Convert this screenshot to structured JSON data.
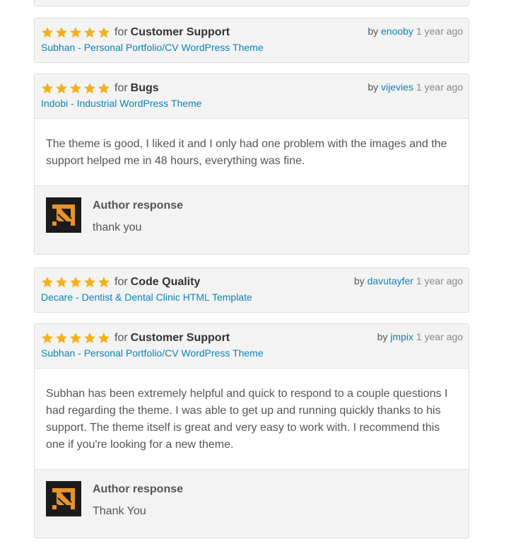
{
  "reviews": [
    {
      "rating": 5,
      "for_label": "for",
      "category": "Customer Support",
      "item": "Subhan - Personal Portfolio/CV WordPress Theme",
      "by_label": "by",
      "user": "enooby",
      "time": "1 year ago"
    },
    {
      "rating": 5,
      "for_label": "for",
      "category": "Bugs",
      "item": "Indobi - Industrial WordPress Theme",
      "by_label": "by",
      "user": "vijevies",
      "time": "1 year ago",
      "body": "The theme is good, I liked it and I only had one problem with the images and the support helped me in 48 hours, everything was fine.",
      "response_title": "Author response",
      "response_text": "thank you"
    },
    {
      "rating": 5,
      "for_label": "for",
      "category": "Code Quality",
      "item": "Decare - Dentist & Dental Clinic HTML Template",
      "by_label": "by",
      "user": "davutayfer",
      "time": "1 year ago"
    },
    {
      "rating": 5,
      "for_label": "for",
      "category": "Customer Support",
      "item": "Subhan - Personal Portfolio/CV WordPress Theme",
      "by_label": "by",
      "user": "jmpix",
      "time": "1 year ago",
      "body": "Subhan has been extremely helpful and quick to respond to a couple questions I had regarding the theme. I was able to get up and running quickly thanks to his support. The theme itself is great and very easy to work with. I recommend this one if you're looking for a new theme.",
      "response_title": "Author response",
      "response_text": "Thank You"
    }
  ],
  "colors": {
    "star": "#f4b21a",
    "link": "#0b84b5",
    "avatar_bg": "#1b1b1b",
    "avatar_fg": "#e8922a"
  },
  "icons": {
    "star": "star-icon",
    "avatar": "author-logo-icon"
  }
}
